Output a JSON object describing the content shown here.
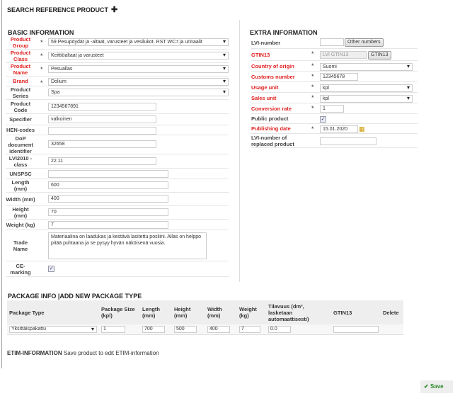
{
  "header": {
    "title": "SEARCH REFERENCE PRODUCT",
    "add_icon": "plus-icon"
  },
  "basic": {
    "heading": "BASIC INFORMATION",
    "product_group": {
      "label": "Product Group",
      "value": "59 Pesupöydät ja -altaat, varusteet ja vesilukot. RST WC:t ja urinaalit"
    },
    "product_class": {
      "label": "Product Class",
      "value": "Keittiöaltaat ja varusteet"
    },
    "product_name": {
      "label": "Product Name",
      "value": "Pesuallas"
    },
    "brand": {
      "label": "Brand",
      "value": "Dolium"
    },
    "product_series": {
      "label": "Product Series",
      "value": "Spa"
    },
    "product_code": {
      "label": "Product Code",
      "value": "1234567891"
    },
    "specifier": {
      "label": "Specifier",
      "value": "valkoinen"
    },
    "hen_codes": {
      "label": "HEN-codes",
      "value": ""
    },
    "dop": {
      "label": "DoP document identifier",
      "value": "32658"
    },
    "lvi2010": {
      "label": "LVI2010 -class",
      "value": "22.11"
    },
    "unspsc": {
      "label": "UNSPSC",
      "value": ""
    },
    "length": {
      "label": "Length (mm)",
      "value": "600"
    },
    "width": {
      "label": "Width (mm)",
      "value": "400"
    },
    "height": {
      "label": "Height (mm)",
      "value": "70"
    },
    "weight": {
      "label": "Weight (kg)",
      "value": "7"
    },
    "trade_name": {
      "label": "Trade Name",
      "value": "Materiaalina on laadukas ja kestävä lasitettu posliini. Allas on helppo pitää puhtaana ja se pysyy hyvän näköisenä vuosia."
    },
    "ce_marking": {
      "label": "CE-marking",
      "checked": true
    }
  },
  "extra": {
    "heading": "EXTRA INFORMATION",
    "lvi_number": {
      "label": "LVI-number",
      "value": "",
      "button": "Other numbers"
    },
    "gtin13": {
      "label": "GTIN13",
      "placeholder": "LVI GTIN13",
      "button": "GTIN13"
    },
    "country": {
      "label": "Country of origin",
      "value": "Suomi"
    },
    "customs": {
      "label": "Customs number",
      "value": "12345678"
    },
    "usage_unit": {
      "label": "Usage unit",
      "value": "kpl"
    },
    "sales_unit": {
      "label": "Sales unit",
      "value": "kpl"
    },
    "conversion": {
      "label": "Conversion rate",
      "value": "1"
    },
    "public": {
      "label": "Public product",
      "checked": true
    },
    "publishing": {
      "label": "Publishing date",
      "value": "15.01.2020"
    },
    "replaced": {
      "label": "LVI-number of replaced product",
      "value": ""
    }
  },
  "required_mark": "*",
  "package": {
    "heading": "PACKAGE INFO |ADD NEW PACKAGE TYPE",
    "columns": [
      "Package Type",
      "Package Size (kpl)",
      "Length (mm)",
      "Height (mm)",
      "Width (mm)",
      "Weight (kg)",
      "Tilavuus (dm³, lasketaan automaattisesti)",
      "GTIN13",
      "Delete"
    ],
    "row": {
      "type": "Yksittäispakattu",
      "size": "1",
      "length": "700",
      "height": "500",
      "width": "400",
      "weight": "7",
      "volume": "0.0",
      "gtin13": ""
    }
  },
  "etim": {
    "label": "ETIM-INFORMATION",
    "text": "Save product to edit ETIM-information"
  },
  "save": {
    "label": "Save"
  },
  "colors": {
    "required": "#e02020",
    "save": "#2a8a2a"
  }
}
